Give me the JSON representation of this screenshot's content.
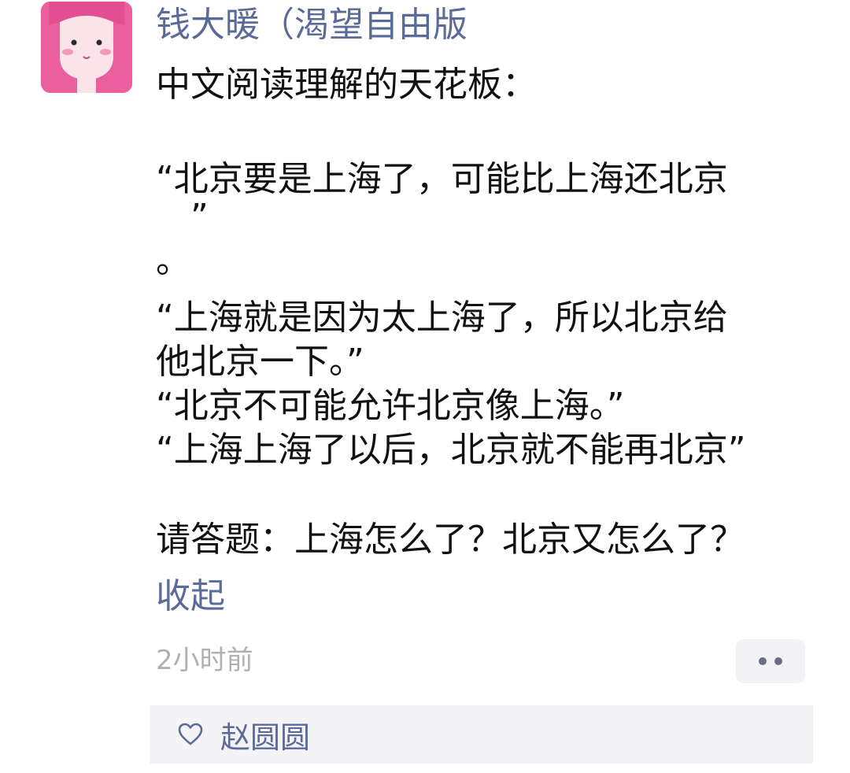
{
  "post": {
    "author": "钱大暖（渴望自由版",
    "avatar_icon": "cartoon-girl-avatar-icon",
    "lines": {
      "intro": "中文阅读理解的天花板：",
      "q1a": "“北京要是上海了，可能比上海还北京",
      "q1b": "”",
      "q1c": "。",
      "q2a": "“上海就是因为太上海了，所以北京给",
      "q2b": "他北京一下。”",
      "q3": "“北京不可能允许北京像上海。”",
      "q4": "“上海上海了以后，北京就不能再北京”",
      "question": "请答题：上海怎么了？北京又怎么了？"
    },
    "collapse_label": "收起",
    "timestamp": "2小时前",
    "more_icon": "more-dots-icon"
  },
  "likes": {
    "icon": "heart-icon",
    "names": "赵圆圆"
  },
  "colors": {
    "link": "#5b6b99",
    "text": "#111111",
    "muted": "#b0b0b0",
    "avatar_bg": "#ec5f9e"
  }
}
